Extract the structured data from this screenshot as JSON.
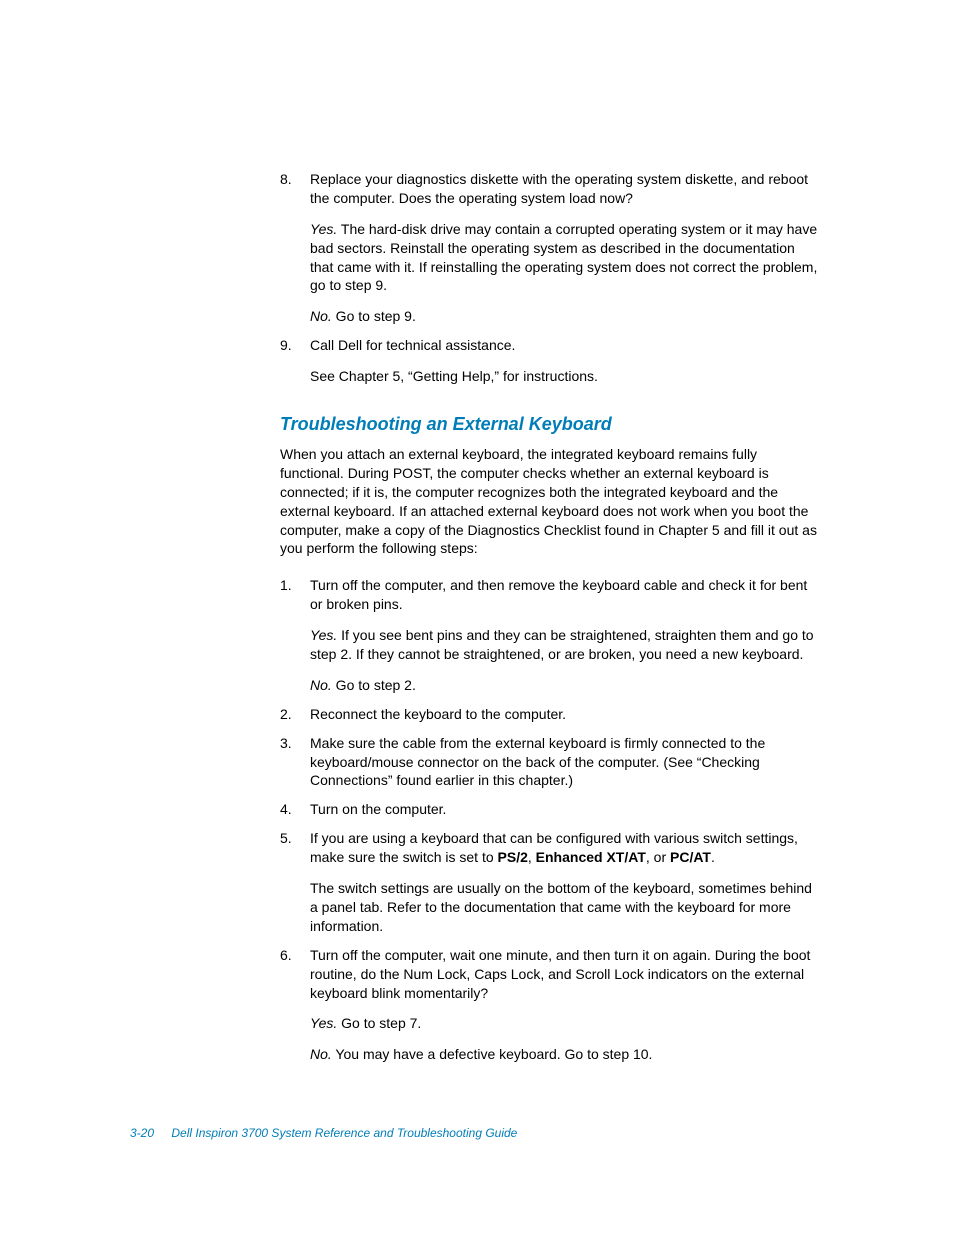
{
  "topList": [
    {
      "num": "8.",
      "paras": [
        {
          "runs": [
            {
              "t": "Replace your diagnostics diskette with the operating system diskette, and reboot the computer. Does the operating system load now?"
            }
          ]
        },
        {
          "runs": [
            {
              "t": "Yes.",
              "style": "italic"
            },
            {
              "t": " The hard-disk drive may contain a corrupted operating system or it may have bad sectors. Reinstall the operating system as described in the documentation that came with it. If reinstalling the operating system does not correct the problem, go to step 9."
            }
          ]
        },
        {
          "runs": [
            {
              "t": "No.",
              "style": "italic"
            },
            {
              "t": " Go to step 9."
            }
          ]
        }
      ]
    },
    {
      "num": "9.",
      "paras": [
        {
          "runs": [
            {
              "t": "Call Dell for technical assistance."
            }
          ]
        },
        {
          "runs": [
            {
              "t": "See Chapter 5, “Getting Help,” for instructions."
            }
          ]
        }
      ]
    }
  ],
  "heading": "Troubleshooting an External Keyboard",
  "intro": "When you attach an external keyboard, the integrated keyboard remains fully functional. During POST, the computer checks whether an external keyboard is connected; if it is, the computer recognizes both the integrated keyboard and the external keyboard. If an attached external keyboard does not work when you boot the computer, make a copy of the Diagnostics Checklist found in Chapter 5 and fill it out as you perform the following steps:",
  "mainList": [
    {
      "num": "1.",
      "paras": [
        {
          "runs": [
            {
              "t": "Turn off the computer, and then remove the keyboard cable and check it for bent or broken pins."
            }
          ]
        },
        {
          "runs": [
            {
              "t": "Yes.",
              "style": "italic"
            },
            {
              "t": " If you see bent pins and they can be straightened, straighten them and go to step 2. If they cannot be straightened, or are broken, you need a new keyboard."
            }
          ]
        },
        {
          "runs": [
            {
              "t": "No.",
              "style": "italic"
            },
            {
              "t": " Go to step 2."
            }
          ]
        }
      ]
    },
    {
      "num": "2.",
      "paras": [
        {
          "runs": [
            {
              "t": "Reconnect the keyboard to the computer."
            }
          ]
        }
      ]
    },
    {
      "num": "3.",
      "paras": [
        {
          "runs": [
            {
              "t": "Make sure the cable from the external keyboard is firmly connected to the keyboard/mouse connector on the back of the computer. (See “Checking Connections” found earlier in this chapter.)"
            }
          ]
        }
      ]
    },
    {
      "num": "4.",
      "paras": [
        {
          "runs": [
            {
              "t": "Turn on the computer."
            }
          ]
        }
      ]
    },
    {
      "num": "5.",
      "paras": [
        {
          "runs": [
            {
              "t": "If you are using a keyboard that can be configured with various switch settings, make sure the switch is set to "
            },
            {
              "t": "PS/2",
              "style": "bold"
            },
            {
              "t": ", "
            },
            {
              "t": "Enhanced XT/AT",
              "style": "bold"
            },
            {
              "t": ", or "
            },
            {
              "t": "PC/AT",
              "style": "bold"
            },
            {
              "t": "."
            }
          ]
        },
        {
          "runs": [
            {
              "t": "The switch settings are usually on the bottom of the keyboard, sometimes behind a panel tab. Refer to the documentation that came with the keyboard for more information."
            }
          ]
        }
      ]
    },
    {
      "num": "6.",
      "paras": [
        {
          "runs": [
            {
              "t": "Turn off the computer, wait one minute, and then turn it on again. During the boot routine, do the Num Lock, Caps Lock, and Scroll Lock indicators on the external keyboard blink momentarily?"
            }
          ]
        },
        {
          "runs": [
            {
              "t": "Yes.",
              "style": "italic"
            },
            {
              "t": " Go to step 7."
            }
          ]
        },
        {
          "runs": [
            {
              "t": "No.",
              "style": "italic"
            },
            {
              "t": " You may have a defective keyboard. Go to step 10."
            }
          ]
        }
      ]
    }
  ],
  "footer": {
    "page": "3-20",
    "title": "Dell Inspiron 3700 System Reference and Troubleshooting Guide"
  }
}
